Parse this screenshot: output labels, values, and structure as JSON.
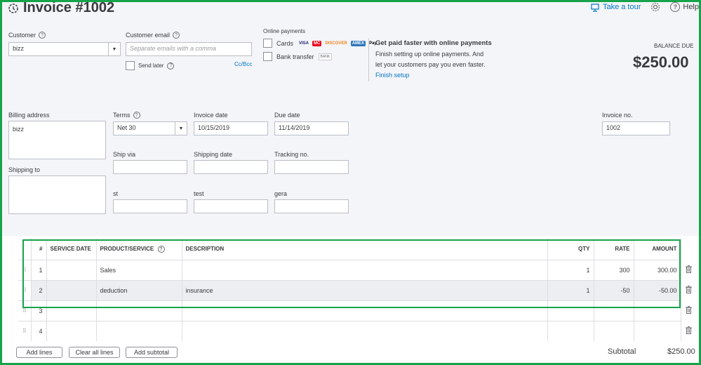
{
  "header": {
    "title": "Invoice #1002",
    "take_tour": "Take a tour",
    "help": "Help"
  },
  "customer": {
    "label": "Customer",
    "value": "bizz"
  },
  "customer_email": {
    "label": "Customer email",
    "placeholder": "Separate emails with a comma",
    "send_later": "Send later",
    "cc_bcc": "Cc/Bcc"
  },
  "online_payments": {
    "label": "Online payments",
    "cards": "Cards",
    "bank_transfer": "Bank transfer",
    "card_brands": [
      "VISA",
      "MC",
      "DISCOVER",
      "AMEX",
      "Pay"
    ],
    "bank_badge": "BANK"
  },
  "promo": {
    "title": "Get paid faster with online payments",
    "line1": "Finish setting up online payments. And",
    "line2": "let your customers pay you even faster.",
    "link": "Finish setup"
  },
  "balance": {
    "label": "BALANCE DUE",
    "amount": "$250.00"
  },
  "billing": {
    "billing_label": "Billing address",
    "billing_value": "bizz",
    "shipping_label": "Shipping to"
  },
  "terms": {
    "label": "Terms",
    "value": "Net 30"
  },
  "invoice_date": {
    "label": "Invoice date",
    "value": "10/15/2019"
  },
  "due_date": {
    "label": "Due date",
    "value": "11/14/2019"
  },
  "invoice_no": {
    "label": "Invoice no.",
    "value": "1002"
  },
  "ship_via": {
    "label": "Ship via"
  },
  "shipping_date": {
    "label": "Shipping date"
  },
  "tracking_no": {
    "label": "Tracking no."
  },
  "custom": {
    "st": "st",
    "test": "test",
    "gera": "gera"
  },
  "table": {
    "headers": [
      "#",
      "SERVICE DATE",
      "PRODUCT/SERVICE",
      "DESCRIPTION",
      "QTY",
      "RATE",
      "AMOUNT"
    ],
    "rows": [
      {
        "num": "1",
        "service_date": "",
        "product": "Sales",
        "description": "",
        "qty": "1",
        "rate": "300",
        "amount": "300.00"
      },
      {
        "num": "2",
        "service_date": "",
        "product": "deduction",
        "description": "insurance",
        "qty": "1",
        "rate": "-50",
        "amount": "-50.00"
      },
      {
        "num": "3",
        "service_date": "",
        "product": "",
        "description": "",
        "qty": "",
        "rate": "",
        "amount": ""
      },
      {
        "num": "4",
        "service_date": "",
        "product": "",
        "description": "",
        "qty": "",
        "rate": "",
        "amount": ""
      }
    ]
  },
  "footer": {
    "add_lines": "Add lines",
    "clear_all": "Clear all lines",
    "add_subtotal": "Add subtotal",
    "subtotal_label": "Subtotal",
    "subtotal_value": "$250.00"
  }
}
